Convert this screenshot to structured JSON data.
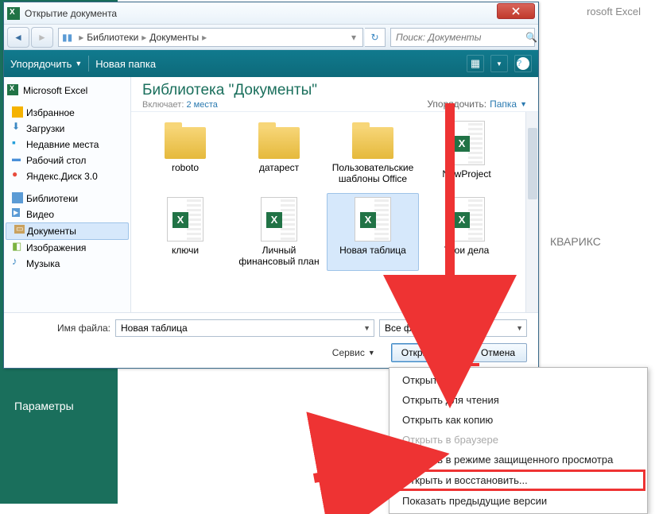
{
  "bg": {
    "excel_title": "rosoft Excel",
    "params": "Параметры",
    "kvariks": "КВАРИКС"
  },
  "dialog": {
    "title": "Открытие документа",
    "breadcrumb": {
      "part1": "Библиотеки",
      "part2": "Документы"
    },
    "search_placeholder": "Поиск: Документы",
    "toolbar": {
      "organize": "Упорядочить",
      "new_folder": "Новая папка"
    },
    "lib_title": "Библиотека \"Документы\"",
    "lib_sub_label": "Включает:",
    "lib_sub_link": "2 места",
    "sort_label": "Упорядочить:",
    "sort_value": "Папка",
    "sidebar": {
      "excel": "Microsoft Excel",
      "fav": "Избранное",
      "fav_items": [
        "Загрузки",
        "Недавние места",
        "Рабочий стол",
        "Яндекс.Диск 3.0"
      ],
      "lib": "Библиотеки",
      "lib_items": [
        "Видео",
        "Документы",
        "Изображения",
        "Музыка"
      ]
    },
    "files": [
      {
        "name": "roboto",
        "type": "folder"
      },
      {
        "name": "датарест",
        "type": "folder"
      },
      {
        "name": "Пользовательские шаблоны Office",
        "type": "folder"
      },
      {
        "name": "NewProject",
        "type": "xls"
      },
      {
        "name": "ключи",
        "type": "xls"
      },
      {
        "name": "Личный финансовый план",
        "type": "xls"
      },
      {
        "name": "Новая таблица",
        "type": "xls",
        "selected": true
      },
      {
        "name": "Твои дела",
        "type": "xls"
      }
    ],
    "filename_label": "Имя файла:",
    "filename_value": "Новая таблица",
    "filter_value": "Все файлы",
    "tools_label": "Сервис",
    "open_btn": "Открыть",
    "cancel_btn": "Отмена"
  },
  "menu": {
    "items": [
      {
        "label": "Открыть",
        "state": "normal"
      },
      {
        "label": "Открыть для чтения",
        "state": "normal"
      },
      {
        "label": "Открыть как копию",
        "state": "normal"
      },
      {
        "label": "Открыть в браузере",
        "state": "disabled"
      },
      {
        "label": "Открыть в режиме защищенного просмотра",
        "state": "normal"
      },
      {
        "label": "Открыть и восстановить...",
        "state": "highlight"
      },
      {
        "label": "Показать предыдущие версии",
        "state": "normal"
      }
    ]
  }
}
